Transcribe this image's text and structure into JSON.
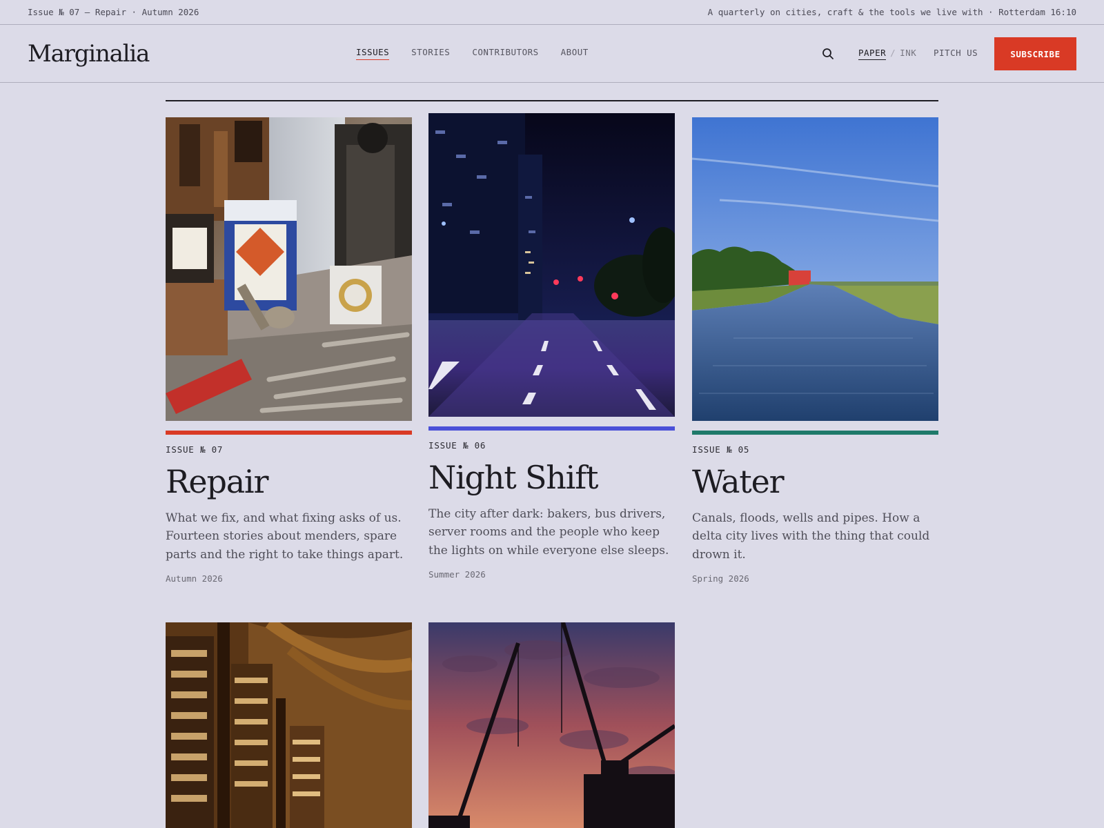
{
  "topbar": {
    "left": "Issue № 07 — Repair · Autumn 2026",
    "right": "A quarterly on cities, craft & the tools we live with · Rotterdam 16:10"
  },
  "header": {
    "logo": "Marginalia",
    "nav": [
      "ISSUES",
      "STORIES",
      "CONTRIBUTORS",
      "ABOUT"
    ],
    "active_nav": "ISSUES",
    "search_icon": "search-icon",
    "mode_paper": "PAPER",
    "mode_sep": "/",
    "mode_ink": "INK",
    "pitch": "PITCH US",
    "subscribe": "SUBSCRIBE"
  },
  "colors": {
    "accent": "#d93a25",
    "background": "#dcdbe8"
  },
  "issues": [
    {
      "label": "ISSUE № 07",
      "title": "Repair",
      "description": "What we fix, and what fixing asks of us. Fourteen stories about menders, spare parts and the right to take things apart.",
      "season": "Autumn 2026",
      "stripe_color": "#d93a25",
      "image": "workshop tools and oil cans"
    },
    {
      "label": "ISSUE № 06",
      "title": "Night Shift",
      "description": "The city after dark: bakers, bus drivers, server rooms and the people who keep the lights on while everyone else sleeps.",
      "season": "Summer 2026",
      "stripe_color": "#4a50d8",
      "image": "city street at night"
    },
    {
      "label": "ISSUE № 05",
      "title": "Water",
      "description": "Canals, floods, wells and pipes. How a delta city lives with the thing that could drown it.",
      "season": "Spring 2026",
      "stripe_color": "#1f7a6a",
      "image": "canal with blue sky"
    },
    {
      "image": "library interior"
    },
    {
      "image": "harbour cranes at sunset"
    }
  ]
}
